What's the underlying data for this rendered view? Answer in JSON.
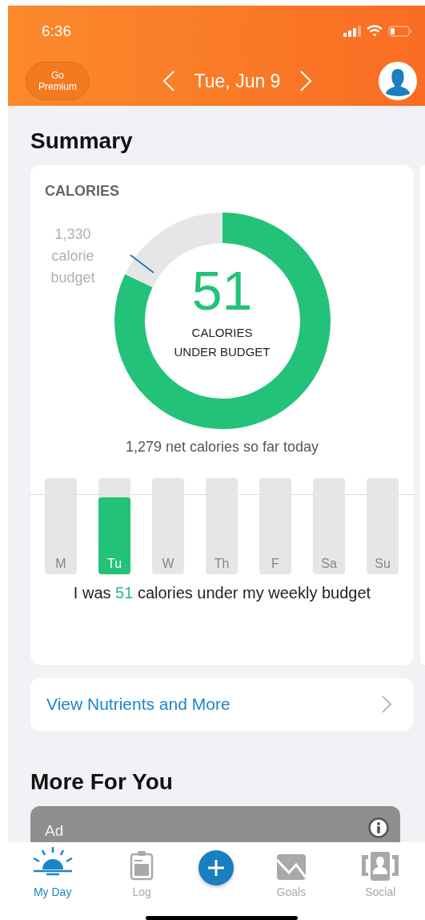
{
  "status_bar": {
    "time": "6:36"
  },
  "header": {
    "premium_button": "Go Premium",
    "date": "Tue, Jun 9"
  },
  "summary": {
    "title": "Summary",
    "calories": {
      "heading": "CALORIES",
      "budget_label": "1,330 calorie budget",
      "level": 0.82,
      "big_number": "51",
      "caption": "CALORIES UNDER BUDGET",
      "net_text": "1,279 net calories so far today"
    },
    "week": [
      {
        "label": "M",
        "selected": false,
        "level": 0
      },
      {
        "label": "Tu",
        "selected": true,
        "level": 0.8
      },
      {
        "label": "W",
        "selected": false,
        "level": 0
      },
      {
        "label": "Th",
        "selected": false,
        "level": 0
      },
      {
        "label": "F",
        "selected": false,
        "level": 0
      },
      {
        "label": "Sa",
        "selected": false,
        "level": 0
      },
      {
        "label": "Su",
        "selected": false,
        "level": 0
      }
    ],
    "weekly_text": "I was **51** calories under my weekly budget"
  },
  "nutrients_link": "View Nutrients and More",
  "more": {
    "title": "More For You",
    "ad_label": "Ad"
  },
  "tabs": [
    {
      "kind": "day",
      "label": "My Day",
      "selected": true
    },
    {
      "kind": "log",
      "label": "Log",
      "selected": false
    },
    {
      "kind": "add",
      "selected": false
    },
    {
      "kind": "goals",
      "label": "Goals",
      "selected": false
    },
    {
      "kind": "social",
      "label": "Social",
      "selected": false
    }
  ]
}
